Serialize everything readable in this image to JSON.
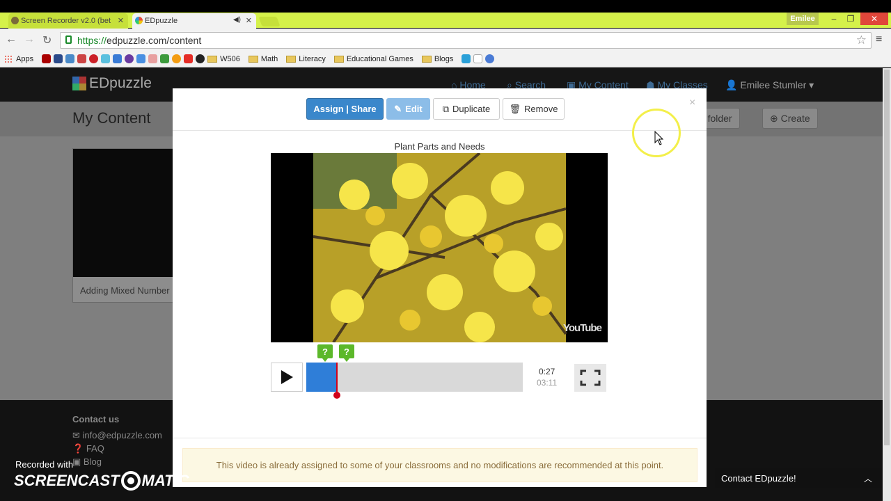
{
  "browser": {
    "tabs": [
      {
        "label": "Screen Recorder v2.0 (bet"
      },
      {
        "label": "EDpuzzle"
      }
    ],
    "user_badge": "Emilee",
    "url_scheme": "https://",
    "url_rest": "edpuzzle.com/content",
    "bookmarks": [
      {
        "label": "Apps"
      },
      {
        "label": "W506"
      },
      {
        "label": "Math"
      },
      {
        "label": "Literacy"
      },
      {
        "label": "Educational Games"
      },
      {
        "label": "Blogs"
      }
    ]
  },
  "site": {
    "logo_text": "EDpuzzle",
    "nav": {
      "home": "Home",
      "search": "Search",
      "my_content": "My Content",
      "my_classes": "My Classes",
      "user": "Emilee Stumler"
    },
    "page_title": "My Content",
    "move_to_folder": "to folder",
    "create": "Create",
    "card_title": "Adding Mixed Number",
    "footer": {
      "heading": "Contact us",
      "email": "info@edpuzzle.com",
      "faq": "FAQ",
      "blog": "Blog"
    }
  },
  "modal": {
    "buttons": {
      "assign": "Assign | Share",
      "edit": "Edit",
      "duplicate": "Duplicate",
      "remove": "Remove"
    },
    "close": "×",
    "video_title": "Plant Parts and Needs",
    "youtube_mark": "YouTube",
    "question_marker": "?",
    "progress_fraction": 0.141,
    "time_current": "0:27",
    "time_total": "03:11",
    "alert_text": "This video is already assigned to some of your classrooms and no modifications are recommended at this point."
  },
  "widgets": {
    "contact": "Contact EDpuzzle!",
    "recorded_with": "Recorded with",
    "screencast": "SCREENCAST",
    "screencast_suffix": "MATIC"
  },
  "colors": {
    "chrome_frame": "#d5f14a",
    "primary_button": "#3a87cb",
    "progress": "#2f7ed8",
    "question_marker": "#5cb82a",
    "alert_bg": "#fcf8e3"
  }
}
